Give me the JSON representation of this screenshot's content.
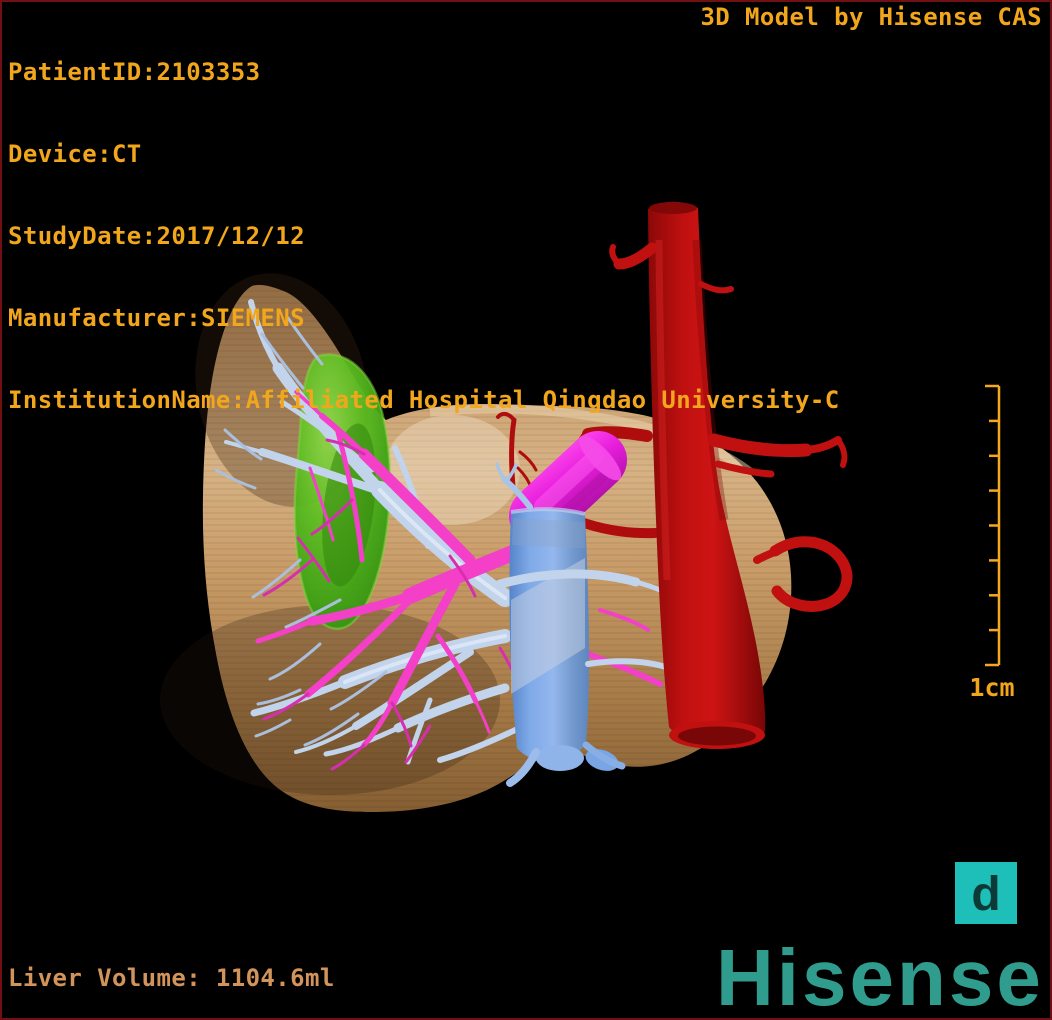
{
  "overlay": {
    "top_left_lines": [
      "PatientID:2103353",
      "Device:CT",
      "StudyDate:2017/12/12",
      "Manufacturer:SIEMENS",
      "InstitutionName:Affiliated Hospital Qingdao University-C"
    ],
    "top_right": "3D Model by Hisense CAS",
    "bottom_left": "Liver Volume: 1104.6ml"
  },
  "scale_bar": {
    "label": "1cm",
    "divisions": 8
  },
  "branding": {
    "wordmark": "Hisense",
    "app_icon_letter": "d"
  },
  "model": {
    "structures": [
      {
        "name": "liver",
        "color": "#C99B68"
      },
      {
        "name": "gallbladder",
        "color": "#5BBE20"
      },
      {
        "name": "hepatic-veins",
        "color": "#C2D3EC"
      },
      {
        "name": "portal-vein",
        "color": "#F43FC9"
      },
      {
        "name": "inferior-vena-cava",
        "color": "#7FA9E8"
      },
      {
        "name": "portal-trunk-tube",
        "color": "#E81EDC"
      },
      {
        "name": "aorta",
        "color": "#C01010"
      }
    ]
  },
  "colors": {
    "accent": "#F2A61C",
    "volume-text": "#D2945A",
    "brand-teal": "#2F9C8E",
    "d-icon-bg": "#1EBEB9",
    "d-icon-glyph": "#0B3A37",
    "border-maroon": "#701013"
  }
}
